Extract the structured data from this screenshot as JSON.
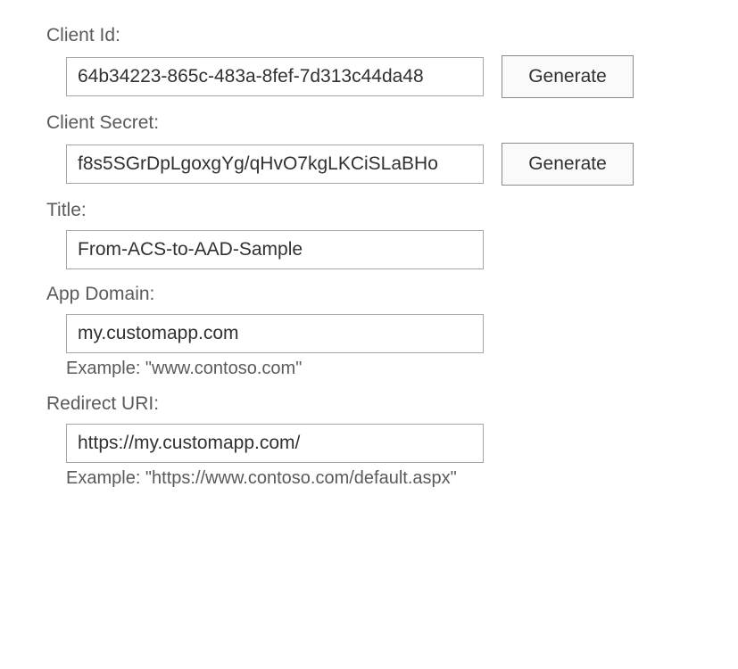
{
  "form": {
    "client_id": {
      "label": "Client Id:",
      "value": "64b34223-865c-483a-8fef-7d313c44da48",
      "generate_label": "Generate"
    },
    "client_secret": {
      "label": "Client Secret:",
      "value": "f8s5SGrDpLgoxgYg/qHvO7kgLKCiSLaBHo",
      "generate_label": "Generate"
    },
    "title": {
      "label": "Title:",
      "value": "From-ACS-to-AAD-Sample"
    },
    "app_domain": {
      "label": "App Domain:",
      "value": "my.customapp.com",
      "example": "Example: \"www.contoso.com\""
    },
    "redirect_uri": {
      "label": "Redirect URI:",
      "value": "https://my.customapp.com/",
      "example": "Example: \"https://www.contoso.com/default.aspx\""
    }
  }
}
